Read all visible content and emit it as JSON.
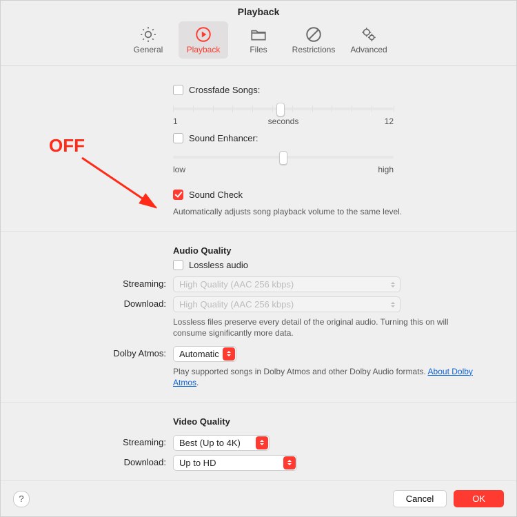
{
  "title": "Playback",
  "tabs": [
    {
      "label": "General"
    },
    {
      "label": "Playback"
    },
    {
      "label": "Files"
    },
    {
      "label": "Restrictions"
    },
    {
      "label": "Advanced"
    }
  ],
  "crossfade": {
    "label": "Crossfade Songs:",
    "min": "1",
    "mid": "seconds",
    "max": "12"
  },
  "enhancer": {
    "label": "Sound Enhancer:",
    "min": "low",
    "max": "high"
  },
  "soundcheck": {
    "label": "Sound Check",
    "desc": "Automatically adjusts song playback volume to the same level."
  },
  "audio": {
    "heading": "Audio Quality",
    "lossless": "Lossless audio",
    "streaming_label": "Streaming:",
    "download_label": "Download:",
    "quality_value": "High Quality (AAC 256 kbps)",
    "note": "Lossless files preserve every detail of the original audio. Turning this on will consume significantly more data.",
    "atmos_label": "Dolby Atmos:",
    "atmos_value": "Automatic",
    "atmos_note": "Play supported songs in Dolby Atmos and other Dolby Audio formats.",
    "atmos_link": "About Dolby Atmos"
  },
  "video": {
    "heading": "Video Quality",
    "streaming_label": "Streaming:",
    "streaming_value": "Best (Up to 4K)",
    "download_label": "Download:",
    "download_value": "Up to HD"
  },
  "footer": {
    "cancel": "Cancel",
    "ok": "OK"
  },
  "annotation": "OFF"
}
